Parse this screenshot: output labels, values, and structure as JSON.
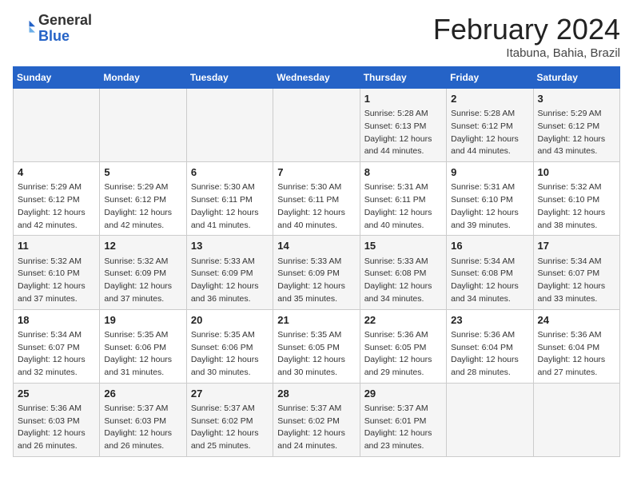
{
  "header": {
    "logo_general": "General",
    "logo_blue": "Blue",
    "month_title": "February 2024",
    "location": "Itabuna, Bahia, Brazil"
  },
  "weekdays": [
    "Sunday",
    "Monday",
    "Tuesday",
    "Wednesday",
    "Thursday",
    "Friday",
    "Saturday"
  ],
  "weeks": [
    [
      {
        "day": "",
        "info": ""
      },
      {
        "day": "",
        "info": ""
      },
      {
        "day": "",
        "info": ""
      },
      {
        "day": "",
        "info": ""
      },
      {
        "day": "1",
        "info": "Sunrise: 5:28 AM\nSunset: 6:13 PM\nDaylight: 12 hours\nand 44 minutes."
      },
      {
        "day": "2",
        "info": "Sunrise: 5:28 AM\nSunset: 6:12 PM\nDaylight: 12 hours\nand 44 minutes."
      },
      {
        "day": "3",
        "info": "Sunrise: 5:29 AM\nSunset: 6:12 PM\nDaylight: 12 hours\nand 43 minutes."
      }
    ],
    [
      {
        "day": "4",
        "info": "Sunrise: 5:29 AM\nSunset: 6:12 PM\nDaylight: 12 hours\nand 42 minutes."
      },
      {
        "day": "5",
        "info": "Sunrise: 5:29 AM\nSunset: 6:12 PM\nDaylight: 12 hours\nand 42 minutes."
      },
      {
        "day": "6",
        "info": "Sunrise: 5:30 AM\nSunset: 6:11 PM\nDaylight: 12 hours\nand 41 minutes."
      },
      {
        "day": "7",
        "info": "Sunrise: 5:30 AM\nSunset: 6:11 PM\nDaylight: 12 hours\nand 40 minutes."
      },
      {
        "day": "8",
        "info": "Sunrise: 5:31 AM\nSunset: 6:11 PM\nDaylight: 12 hours\nand 40 minutes."
      },
      {
        "day": "9",
        "info": "Sunrise: 5:31 AM\nSunset: 6:10 PM\nDaylight: 12 hours\nand 39 minutes."
      },
      {
        "day": "10",
        "info": "Sunrise: 5:32 AM\nSunset: 6:10 PM\nDaylight: 12 hours\nand 38 minutes."
      }
    ],
    [
      {
        "day": "11",
        "info": "Sunrise: 5:32 AM\nSunset: 6:10 PM\nDaylight: 12 hours\nand 37 minutes."
      },
      {
        "day": "12",
        "info": "Sunrise: 5:32 AM\nSunset: 6:09 PM\nDaylight: 12 hours\nand 37 minutes."
      },
      {
        "day": "13",
        "info": "Sunrise: 5:33 AM\nSunset: 6:09 PM\nDaylight: 12 hours\nand 36 minutes."
      },
      {
        "day": "14",
        "info": "Sunrise: 5:33 AM\nSunset: 6:09 PM\nDaylight: 12 hours\nand 35 minutes."
      },
      {
        "day": "15",
        "info": "Sunrise: 5:33 AM\nSunset: 6:08 PM\nDaylight: 12 hours\nand 34 minutes."
      },
      {
        "day": "16",
        "info": "Sunrise: 5:34 AM\nSunset: 6:08 PM\nDaylight: 12 hours\nand 34 minutes."
      },
      {
        "day": "17",
        "info": "Sunrise: 5:34 AM\nSunset: 6:07 PM\nDaylight: 12 hours\nand 33 minutes."
      }
    ],
    [
      {
        "day": "18",
        "info": "Sunrise: 5:34 AM\nSunset: 6:07 PM\nDaylight: 12 hours\nand 32 minutes."
      },
      {
        "day": "19",
        "info": "Sunrise: 5:35 AM\nSunset: 6:06 PM\nDaylight: 12 hours\nand 31 minutes."
      },
      {
        "day": "20",
        "info": "Sunrise: 5:35 AM\nSunset: 6:06 PM\nDaylight: 12 hours\nand 30 minutes."
      },
      {
        "day": "21",
        "info": "Sunrise: 5:35 AM\nSunset: 6:05 PM\nDaylight: 12 hours\nand 30 minutes."
      },
      {
        "day": "22",
        "info": "Sunrise: 5:36 AM\nSunset: 6:05 PM\nDaylight: 12 hours\nand 29 minutes."
      },
      {
        "day": "23",
        "info": "Sunrise: 5:36 AM\nSunset: 6:04 PM\nDaylight: 12 hours\nand 28 minutes."
      },
      {
        "day": "24",
        "info": "Sunrise: 5:36 AM\nSunset: 6:04 PM\nDaylight: 12 hours\nand 27 minutes."
      }
    ],
    [
      {
        "day": "25",
        "info": "Sunrise: 5:36 AM\nSunset: 6:03 PM\nDaylight: 12 hours\nand 26 minutes."
      },
      {
        "day": "26",
        "info": "Sunrise: 5:37 AM\nSunset: 6:03 PM\nDaylight: 12 hours\nand 26 minutes."
      },
      {
        "day": "27",
        "info": "Sunrise: 5:37 AM\nSunset: 6:02 PM\nDaylight: 12 hours\nand 25 minutes."
      },
      {
        "day": "28",
        "info": "Sunrise: 5:37 AM\nSunset: 6:02 PM\nDaylight: 12 hours\nand 24 minutes."
      },
      {
        "day": "29",
        "info": "Sunrise: 5:37 AM\nSunset: 6:01 PM\nDaylight: 12 hours\nand 23 minutes."
      },
      {
        "day": "",
        "info": ""
      },
      {
        "day": "",
        "info": ""
      }
    ]
  ]
}
